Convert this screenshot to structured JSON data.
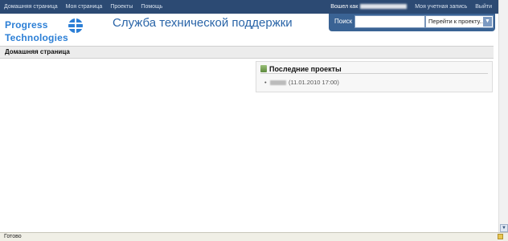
{
  "topnav": {
    "left": [
      "Домашняя страница",
      "Моя страница",
      "Проекты",
      "Помощь"
    ],
    "login_label": "Вошел как",
    "account": "Моя учетная запись",
    "logout": "Выйти"
  },
  "logo": {
    "line1": "Progress",
    "line2": "Technologies"
  },
  "header": {
    "title": "Служба технической поддержки"
  },
  "search": {
    "label": "Поиск",
    "value": "",
    "jump": "Перейти к проекту..."
  },
  "page": {
    "title": "Домашняя страница"
  },
  "projects": {
    "heading": "Последние проекты",
    "items": [
      {
        "date": "(11.01.2010 17:00)"
      }
    ]
  },
  "status": {
    "text": "Готово"
  }
}
